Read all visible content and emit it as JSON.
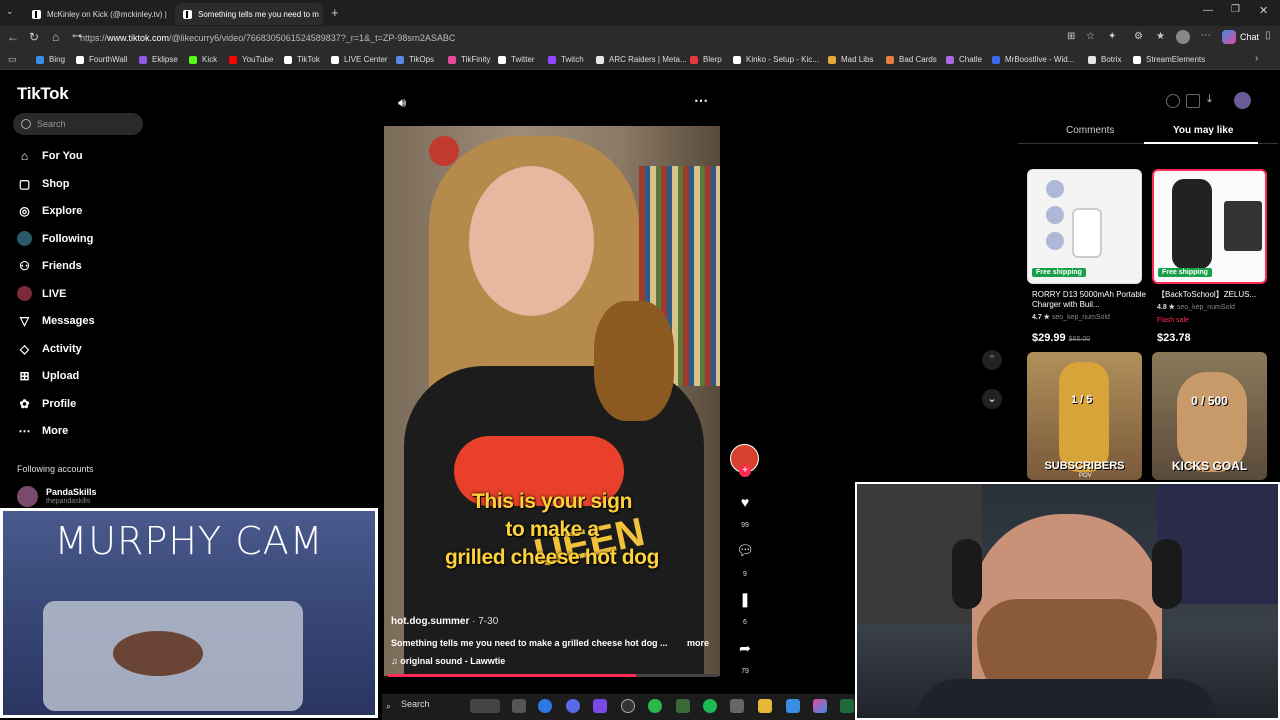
{
  "browser": {
    "tabs": [
      {
        "title": "McKinley on Kick (@mckinley.tv) | ",
        "active": false
      },
      {
        "title": "Something tells me you need to m",
        "active": true
      }
    ],
    "url_prefix": "https://",
    "url_host": "www.tiktok.com",
    "url_path": "/@likecurry6/video/7668305061524589837?_r=1&_t=ZP-98srn2ASABC",
    "chat_label": "Chat",
    "bookmarks": [
      {
        "label": "Bing",
        "color": "#3a8ee6"
      },
      {
        "label": "FourthWall",
        "color": "#ffffff"
      },
      {
        "label": "Eklipse",
        "color": "#8a5ae6"
      },
      {
        "label": "Kick",
        "color": "#53fc18"
      },
      {
        "label": "YouTube",
        "color": "#ff0000"
      },
      {
        "label": "TikTok",
        "color": "#ffffff"
      },
      {
        "label": "LIVE Center",
        "color": "#ffffff"
      },
      {
        "label": "TikOps",
        "color": "#5a8ae6"
      },
      {
        "label": "TikFinity",
        "color": "#e64a9a"
      },
      {
        "label": "Twitter",
        "color": "#ffffff"
      },
      {
        "label": "Twitch",
        "color": "#9146ff"
      },
      {
        "label": "ARC Raiders | Meta...",
        "color": "#e6e6e6"
      },
      {
        "label": "Blerp",
        "color": "#e63a3a"
      },
      {
        "label": "Kinko - Setup - Kic...",
        "color": "#ffffff"
      },
      {
        "label": "Mad Libs",
        "color": "#e6a63a"
      },
      {
        "label": "Bad Cards",
        "color": "#e6803a"
      },
      {
        "label": "Chatle",
        "color": "#a66ae6"
      },
      {
        "label": "MrBoostlive - Wid...",
        "color": "#3a6ae6"
      },
      {
        "label": "Botrix",
        "color": "#e6e6e6"
      },
      {
        "label": "StreamElements",
        "color": "#ffffff"
      }
    ]
  },
  "tiktok": {
    "logo": "TikTok",
    "search_placeholder": "Search",
    "nav": [
      {
        "label": "For You",
        "icon": "home-icon"
      },
      {
        "label": "Shop",
        "icon": "shop-icon"
      },
      {
        "label": "Explore",
        "icon": "compass-icon"
      },
      {
        "label": "Following",
        "icon": "following-icon"
      },
      {
        "label": "Friends",
        "icon": "friends-icon"
      },
      {
        "label": "LIVE",
        "icon": "live-icon"
      },
      {
        "label": "Messages",
        "icon": "messages-icon"
      },
      {
        "label": "Activity",
        "icon": "activity-icon"
      },
      {
        "label": "Upload",
        "icon": "upload-icon"
      },
      {
        "label": "Profile",
        "icon": "profile-icon"
      },
      {
        "label": "More",
        "icon": "more-icon"
      }
    ],
    "following_header": "Following accounts",
    "following": [
      {
        "name": "PandaSkills",
        "handle": "thepandaskills"
      }
    ],
    "video": {
      "caption_lines": [
        "This is your sign",
        "to make a",
        "grilled cheese hot dog"
      ],
      "shirt_text": "UEEN",
      "author": "hot.dog.summer",
      "date": "7-30",
      "description": "Something tells me you need to make a grilled cheese hot dog ...",
      "more": "more",
      "sound": "original sound - Lawwtie",
      "progress": 0.75,
      "likes": "99",
      "comments": "9",
      "saves": "6",
      "shares": "79"
    },
    "panel": {
      "tabs": [
        "Comments",
        "You may like"
      ],
      "products": [
        {
          "badge": "Free shipping",
          "title": "RORRY D13 5000mAh Portable Charger with Buil...",
          "rating": "4.7 ★",
          "sold": "seo_kep_numSold",
          "price": "$29.99",
          "old_price": "$65.00",
          "flash": ""
        },
        {
          "badge": "Free shipping",
          "title": "【BackToSchool】ZELUS...",
          "rating": "4.8 ★",
          "sold": "seo_kep_numSold",
          "price": "$23.78",
          "old_price": "",
          "flash": "Flash sale"
        }
      ],
      "videos": [
        {
          "counter": "1 / 5",
          "label": "SUBSCRIBERS",
          "sub": "POV"
        },
        {
          "counter": "0 / 500",
          "label": "KICKS GOAL",
          "sub": ""
        }
      ]
    }
  },
  "overlays": {
    "murphy_cam_title": "MURPHY CAM"
  },
  "taskbar": {
    "search_label": "Search"
  }
}
